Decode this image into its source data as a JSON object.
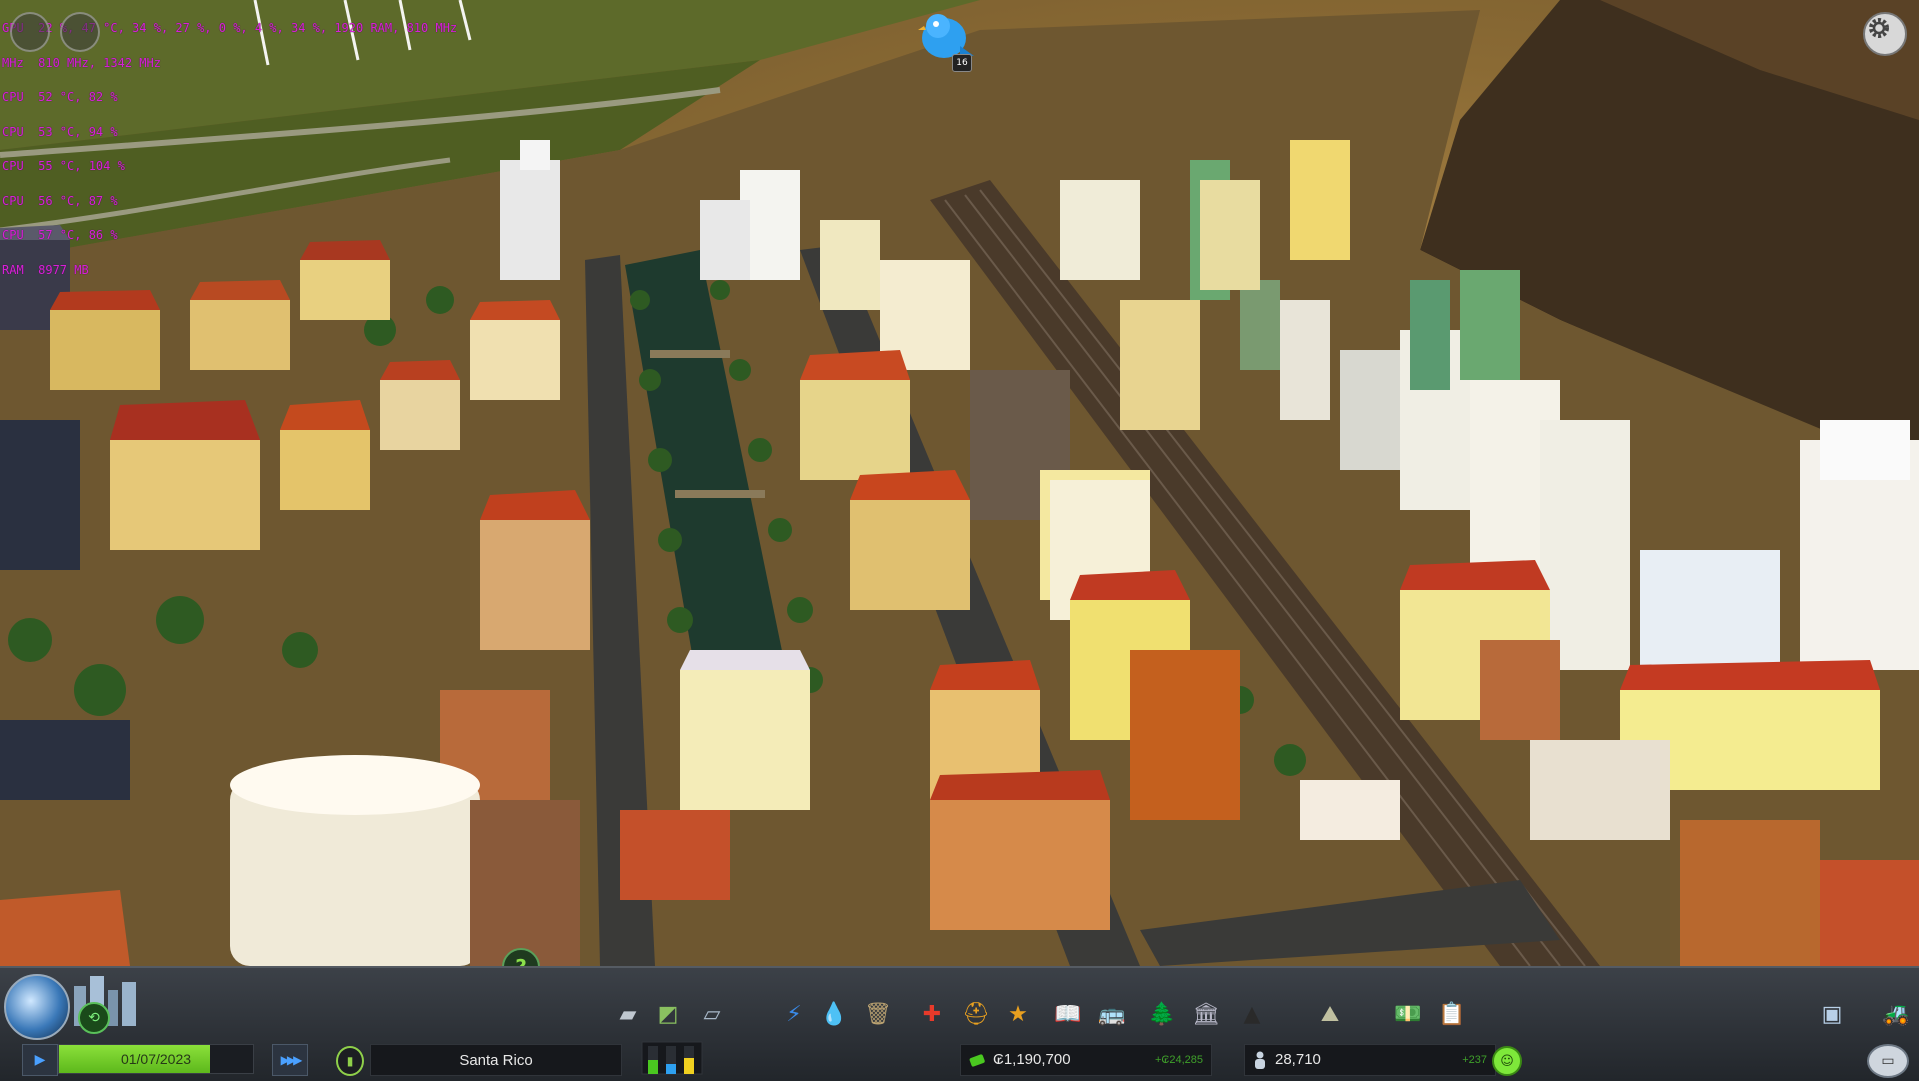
{
  "perf_overlay": {
    "lines": [
      "GPU  22 %, 47 °C, 34 %, 27 %, 0 %, 4 %, 34 %, 1920 RAM, 810 MHz",
      "MHz  810 MHz, 1342 MHz",
      "CPU  52 °C, 82 %",
      "CPU  53 °C, 94 %",
      "CPU  55 °C, 104 %",
      "CPU  56 °C, 87 %",
      "CPU  57 °C, 86 %",
      "RAM  8977 MB"
    ]
  },
  "chirper": {
    "icon": "chirper-bird-icon",
    "badge": "16"
  },
  "settings": {
    "icon": "gear-icon"
  },
  "help": {
    "label": "?"
  },
  "bottombar": {
    "toolbar": [
      {
        "name": "roads-tool",
        "icon": "road-icon",
        "glyph": "▰"
      },
      {
        "name": "zoning-tool",
        "icon": "zoning-icon",
        "glyph": "◩"
      },
      {
        "name": "districts-tool",
        "icon": "district-icon",
        "glyph": "▱"
      },
      {
        "name": "electricity-tool",
        "icon": "lightning-icon",
        "glyph": "⚡"
      },
      {
        "name": "water-tool",
        "icon": "water-drop-icon",
        "glyph": "💧"
      },
      {
        "name": "garbage-tool",
        "icon": "garbage-icon",
        "glyph": "🗑"
      },
      {
        "name": "healthcare-tool",
        "icon": "healthcare-icon",
        "glyph": "✚"
      },
      {
        "name": "fire-tool",
        "icon": "fire-helmet-icon",
        "glyph": "⛑"
      },
      {
        "name": "police-tool",
        "icon": "police-badge-icon",
        "glyph": "★"
      },
      {
        "name": "education-tool",
        "icon": "book-icon",
        "glyph": "📖"
      },
      {
        "name": "transport-tool",
        "icon": "bus-icon",
        "glyph": "🚌"
      },
      {
        "name": "parks-tool",
        "icon": "tree-icon",
        "glyph": "🌲"
      },
      {
        "name": "unique-buildings-tool",
        "icon": "monument-icon",
        "glyph": "🏛"
      },
      {
        "name": "monuments-tool",
        "icon": "pyramid-icon",
        "glyph": "▲"
      },
      {
        "name": "landscaping-tool",
        "icon": "landscaping-icon",
        "glyph": "⛰"
      },
      {
        "name": "economy-tool",
        "icon": "money-icon",
        "glyph": "💵"
      },
      {
        "name": "policies-tool",
        "icon": "clipboard-icon",
        "glyph": "📋"
      },
      {
        "name": "info-views-tool",
        "icon": "info-views-icon",
        "glyph": "▣"
      },
      {
        "name": "bulldozer-tool",
        "icon": "bulldozer-icon",
        "glyph": "🚜"
      }
    ],
    "date": "01/07/2023",
    "date_progress": 0.78,
    "city_name": "Santa Rico",
    "money": "₢1,190,700",
    "money_delta": "+₢24,285",
    "population": "28,710",
    "population_delta": "+237",
    "happiness": "☺",
    "play_glyph": "▶",
    "speed_glyph": "▶▶▶",
    "free_camera_glyph": "▭"
  }
}
